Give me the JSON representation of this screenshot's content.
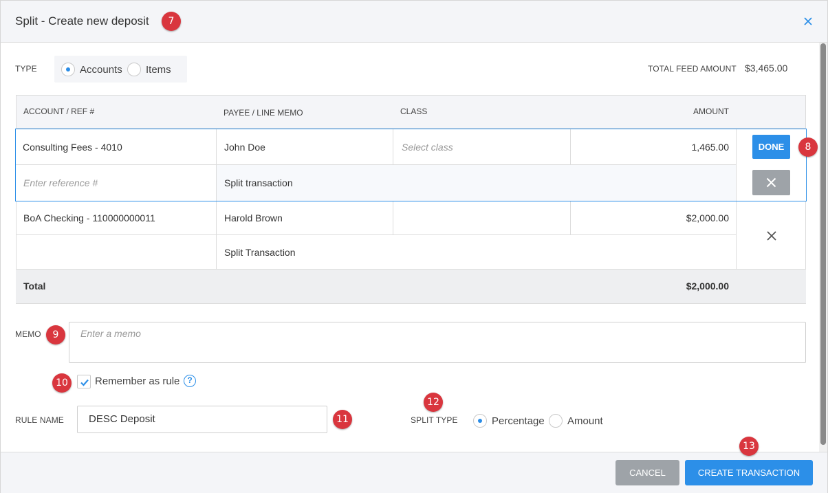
{
  "dialog": {
    "title": "Split - Create new deposit",
    "close_icon": "close-icon"
  },
  "type": {
    "label": "TYPE",
    "options": [
      "Accounts",
      "Items"
    ],
    "selected": "Accounts"
  },
  "total_feed": {
    "label": "TOTAL FEED AMOUNT",
    "value": "$3,465.00"
  },
  "table": {
    "headers": [
      "ACCOUNT / REF #",
      "PAYEE / LINE MEMO",
      "CLASS",
      "AMOUNT"
    ],
    "edit_row": {
      "account": "Consulting Fees - 4010",
      "payee": "John Doe",
      "class_placeholder": "Select class",
      "amount": "1,465.00",
      "ref_placeholder": "Enter reference #",
      "memo": "Split transaction",
      "done_label": "DONE"
    },
    "row2": {
      "account": "BoA Checking - 110000000011",
      "payee": "Harold Brown",
      "amount": "$2,000.00",
      "memo": "Split Transaction"
    },
    "total": {
      "label": "Total",
      "amount": "$2,000.00"
    }
  },
  "memo": {
    "label": "MEMO",
    "placeholder": "Enter a memo"
  },
  "remember": {
    "label": "Remember as rule",
    "checked": true,
    "help": "?"
  },
  "rule_name": {
    "label": "RULE NAME",
    "value": "DESC Deposit"
  },
  "split_type": {
    "label": "SPLIT TYPE",
    "options": [
      "Percentage",
      "Amount"
    ],
    "selected": "Percentage"
  },
  "footer": {
    "cancel": "CANCEL",
    "create": "CREATE TRANSACTION"
  },
  "badges": [
    "7",
    "8",
    "9",
    "10",
    "11",
    "12",
    "13"
  ],
  "colors": {
    "accent": "#2c8fe8",
    "badge": "#d9363e",
    "header_bg": "#f4f5f8",
    "muted_button": "#9ea3a8"
  }
}
